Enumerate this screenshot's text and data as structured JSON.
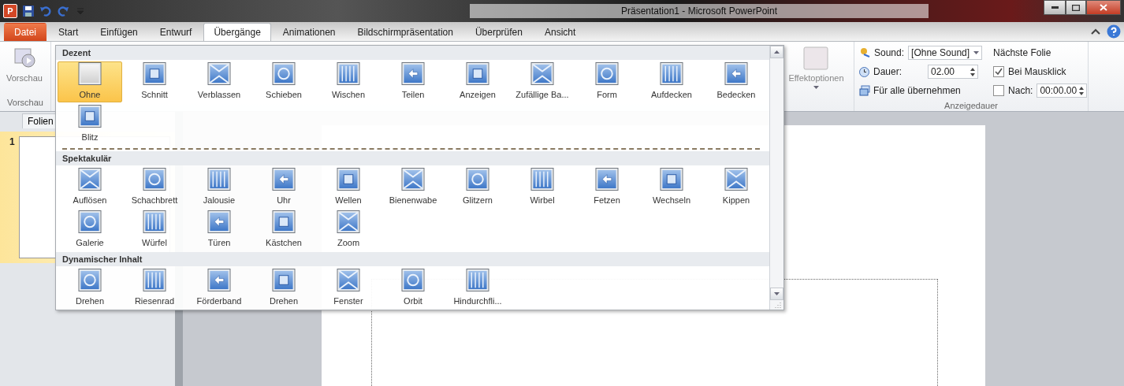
{
  "window": {
    "title": "Präsentation1 - Microsoft PowerPoint",
    "app_letter": "P"
  },
  "tabs": [
    {
      "label": "Datei",
      "kind": "file",
      "selected": false
    },
    {
      "label": "Start",
      "kind": "tab",
      "selected": false
    },
    {
      "label": "Einfügen",
      "kind": "tab",
      "selected": false
    },
    {
      "label": "Entwurf",
      "kind": "tab",
      "selected": false
    },
    {
      "label": "Übergänge",
      "kind": "tab",
      "selected": true
    },
    {
      "label": "Animationen",
      "kind": "tab",
      "selected": false
    },
    {
      "label": "Bildschirmpräsentation",
      "kind": "tab",
      "selected": false
    },
    {
      "label": "Überprüfen",
      "kind": "tab",
      "selected": false
    },
    {
      "label": "Ansicht",
      "kind": "tab",
      "selected": false
    }
  ],
  "ribbon": {
    "preview": {
      "button": "Vorschau",
      "group": "Vorschau"
    },
    "effect_options": {
      "label": "Effektoptionen",
      "disabled": true
    },
    "timing": {
      "group": "Anzeigedauer",
      "sound_label": "Sound:",
      "sound_value": "[Ohne Sound]",
      "duration_label": "Dauer:",
      "duration_value": "02.00",
      "apply_all": "Für alle übernehmen",
      "next_slide": {
        "heading": "Nächste Folie",
        "on_click": {
          "label": "Bei Mausklick",
          "checked": true
        },
        "after": {
          "label": "Nach:",
          "checked": false,
          "value": "00:00.00"
        }
      }
    }
  },
  "slides_pane": {
    "tab": "Folien",
    "slides": [
      {
        "number": "1",
        "selected": true
      }
    ]
  },
  "gallery": {
    "sections": [
      {
        "title": "Dezent",
        "items": [
          {
            "label": "Ohne",
            "selected": true
          },
          {
            "label": "Schnitt",
            "selected": false
          },
          {
            "label": "Verblassen",
            "selected": false
          },
          {
            "label": "Schieben",
            "selected": false
          },
          {
            "label": "Wischen",
            "selected": false
          },
          {
            "label": "Teilen",
            "selected": false
          },
          {
            "label": "Anzeigen",
            "selected": false
          },
          {
            "label": "Zufällige Ba...",
            "selected": false
          },
          {
            "label": "Form",
            "selected": false
          },
          {
            "label": "Aufdecken",
            "selected": false
          },
          {
            "label": "Bedecken",
            "selected": false
          },
          {
            "label": "Blitz",
            "selected": false
          }
        ]
      },
      {
        "title": "Spektakulär",
        "items": [
          {
            "label": "Auflösen",
            "selected": false
          },
          {
            "label": "Schachbrett",
            "selected": false
          },
          {
            "label": "Jalousie",
            "selected": false
          },
          {
            "label": "Uhr",
            "selected": false
          },
          {
            "label": "Wellen",
            "selected": false
          },
          {
            "label": "Bienenwabe",
            "selected": false
          },
          {
            "label": "Glitzern",
            "selected": false
          },
          {
            "label": "Wirbel",
            "selected": false
          },
          {
            "label": "Fetzen",
            "selected": false
          },
          {
            "label": "Wechseln",
            "selected": false
          },
          {
            "label": "Kippen",
            "selected": false
          },
          {
            "label": "Galerie",
            "selected": false
          },
          {
            "label": "Würfel",
            "selected": false
          },
          {
            "label": "Türen",
            "selected": false
          },
          {
            "label": "Kästchen",
            "selected": false
          },
          {
            "label": "Zoom",
            "selected": false
          }
        ]
      },
      {
        "title": "Dynamischer Inhalt",
        "items": [
          {
            "label": "Drehen",
            "selected": false
          },
          {
            "label": "Riesenrad",
            "selected": false
          },
          {
            "label": "Förderband",
            "selected": false
          },
          {
            "label": "Drehen",
            "selected": false
          },
          {
            "label": "Fenster",
            "selected": false
          },
          {
            "label": "Orbit",
            "selected": false
          },
          {
            "label": "Hindurchfli...",
            "selected": false
          }
        ]
      }
    ]
  }
}
